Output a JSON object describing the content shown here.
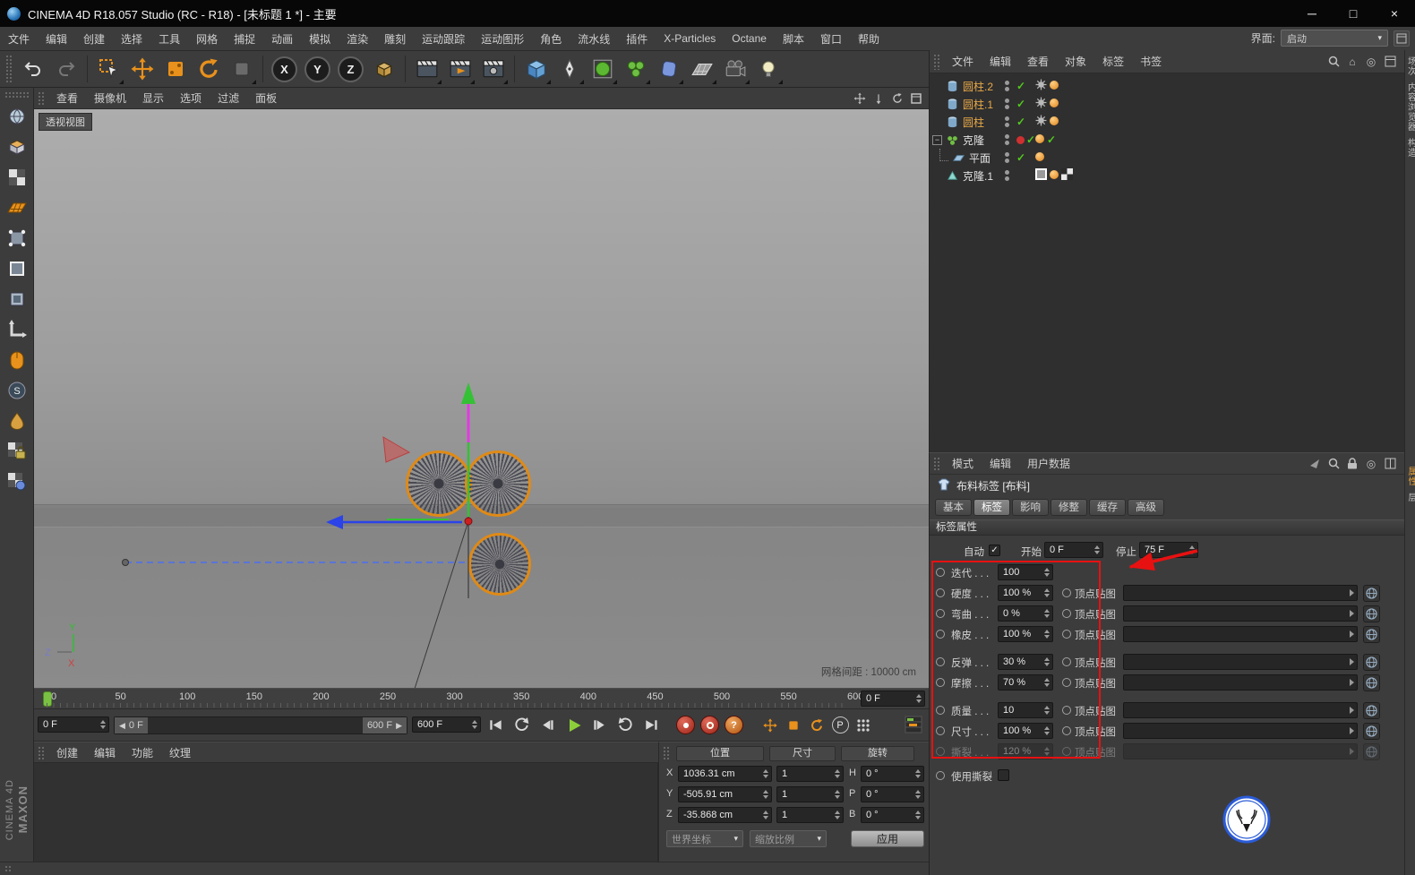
{
  "colors": {
    "accent_orange": "#e8911c",
    "check_green": "#52c91e",
    "annotation_red": "#e81111",
    "axis_green": "#35c135",
    "axis_blue": "#2b43e8",
    "axis_magenta": "#e23ae2",
    "play_green": "#8ccf3a",
    "frame_marker_green": "#7ac143"
  },
  "icons": {
    "minimize": "─",
    "maximize": "□",
    "close": "×",
    "dropdown_caret": "▾",
    "check": "✓",
    "home": "⌂",
    "expander_open": "−",
    "range_left": "◀",
    "range_right": "▶",
    "letter_p": "P",
    "question": "?",
    "target": "◎"
  },
  "titlebar": {
    "title": "CINEMA 4D R18.057 Studio (RC - R18) - [未标题 1 *] - 主要"
  },
  "menubar": {
    "items": [
      "文件",
      "编辑",
      "创建",
      "选择",
      "工具",
      "网格",
      "捕捉",
      "动画",
      "模拟",
      "渲染",
      "雕刻",
      "运动跟踪",
      "运动图形",
      "角色",
      "流水线",
      "插件",
      "X-Particles",
      "Octane",
      "脚本",
      "窗口",
      "帮助"
    ],
    "interface_label": "界面:",
    "interface_value": "启动"
  },
  "toolbar": {
    "x": "X",
    "y": "Y",
    "z": "Z"
  },
  "viewport": {
    "menu": [
      "查看",
      "摄像机",
      "显示",
      "选项",
      "过滤",
      "面板"
    ],
    "view_label": "透视视图",
    "grid_spacing": "网格间距 : 10000 cm",
    "axis_labels": {
      "x": "X",
      "y": "Y",
      "z": "Z"
    }
  },
  "timeline": {
    "ticks": [
      "0",
      "50",
      "100",
      "150",
      "200",
      "250",
      "300",
      "350",
      "400",
      "450",
      "500",
      "550",
      "600"
    ],
    "current_frame": "0 F",
    "range_start": "0 F",
    "range_end": "600 F",
    "end_frame": "600 F"
  },
  "object_manager": {
    "menu": [
      "文件",
      "编辑",
      "查看",
      "对象",
      "标签",
      "书签"
    ],
    "objects": [
      {
        "name": "圆柱.2",
        "icon": "cylinder",
        "name_class": "orange",
        "marks": [
          "check"
        ],
        "tags": [
          "burst",
          "orange"
        ]
      },
      {
        "name": "圆柱.1",
        "icon": "cylinder",
        "name_class": "orange",
        "marks": [
          "check"
        ],
        "tags": [
          "burst",
          "orange"
        ]
      },
      {
        "name": "圆柱",
        "icon": "cylinder",
        "name_class": "orange",
        "marks": [
          "check"
        ],
        "tags": [
          "burst",
          "orange"
        ]
      },
      {
        "name": "克隆",
        "icon": "cloner",
        "exp": true,
        "marks": [
          "reddot",
          "check"
        ],
        "tags": [
          "orange",
          "check"
        ]
      },
      {
        "name": "平面",
        "icon": "plane",
        "child": true,
        "marks": [
          "check"
        ],
        "tags": [
          "orange"
        ]
      },
      {
        "name": "克隆.1",
        "icon": "cone",
        "marks": [],
        "tags": [
          "selected",
          "orange",
          "checker"
        ]
      }
    ]
  },
  "attribute_manager": {
    "menu": [
      "模式",
      "编辑",
      "用户数据"
    ],
    "title": "布料标签 [布料]",
    "tabs": [
      {
        "label": "基本"
      },
      {
        "label": "标签",
        "active": true
      },
      {
        "label": "影响"
      },
      {
        "label": "修整"
      },
      {
        "label": "缓存"
      },
      {
        "label": "高级"
      }
    ],
    "section": "标签属性",
    "auto_label": "自动",
    "auto_checked": true,
    "start_label": "开始",
    "start_value": "0 F",
    "stop_label": "停止",
    "stop_value": "75 F",
    "map_label": "顶点贴图",
    "rows": [
      {
        "key": "iterations",
        "label": "迭代 . . .",
        "value": "100",
        "has_map": false
      },
      {
        "key": "stiffness",
        "label": "硬度 . . .",
        "value": "100 %",
        "has_map": true
      },
      {
        "key": "flexion",
        "label": "弯曲 . . .",
        "value": "0 %",
        "has_map": true
      },
      {
        "key": "rubber",
        "label": "橡皮 . . .",
        "value": "100 %",
        "has_map": true
      },
      {
        "key": "bounce",
        "label": "反弹 . . .",
        "value": "30 %",
        "has_map": true,
        "gap_before": true
      },
      {
        "key": "friction",
        "label": "摩擦 . . .",
        "value": "70 %",
        "has_map": true
      },
      {
        "key": "mass",
        "label": "质量 . . .",
        "value": "10",
        "has_map": true,
        "gap_before": true
      },
      {
        "key": "size",
        "label": "尺寸 . . .",
        "value": "100 %",
        "has_map": true
      },
      {
        "key": "tear",
        "label": "撕裂 . . .",
        "value": "120 %",
        "has_map": true,
        "disabled": true
      }
    ],
    "use_tear_label": "使用撕裂",
    "use_tear_checked": false
  },
  "coordinate_manager": {
    "headers": [
      "位置",
      "尺寸",
      "旋转"
    ],
    "rows": [
      {
        "axis": "X",
        "pos": "1036.31 cm",
        "size": "1",
        "rot_axis": "H",
        "rot": "0 °"
      },
      {
        "axis": "Y",
        "pos": "-505.91 cm",
        "size": "1",
        "rot_axis": "P",
        "rot": "0 °"
      },
      {
        "axis": "Z",
        "pos": "-35.868 cm",
        "size": "1",
        "rot_axis": "B",
        "rot": "0 °"
      }
    ],
    "coord_system": "世界坐标",
    "scale_mode": "缩放比例",
    "apply_label": "应用"
  },
  "material_manager": {
    "menu": [
      "创建",
      "编辑",
      "功能",
      "纹理"
    ]
  },
  "side_tabs": {
    "top": [
      "场次",
      "内容浏览器",
      "构造"
    ],
    "middle": [
      {
        "label": "属性",
        "active": true
      },
      {
        "label": "层"
      }
    ]
  },
  "branding": {
    "line1": "MAXON",
    "line2": "CINEMA 4D"
  }
}
